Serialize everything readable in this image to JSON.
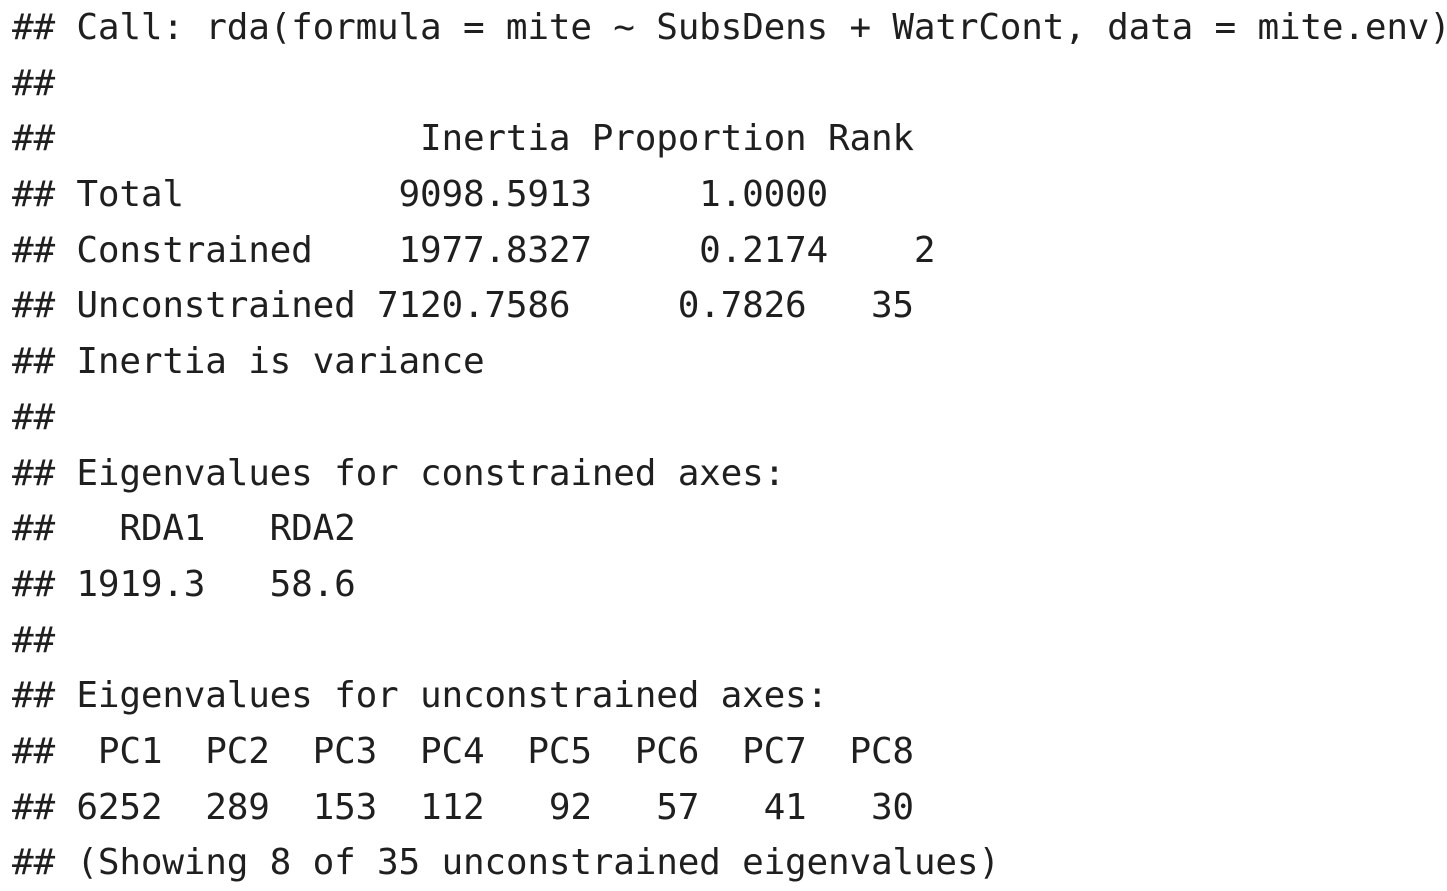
{
  "output": {
    "lines": [
      "## Call: rda(formula = mite ~ SubsDens + WatrCont, data = mite.env)",
      "##",
      "##                 Inertia Proportion Rank",
      "## Total          9098.5913     1.0000",
      "## Constrained    1977.8327     0.2174    2",
      "## Unconstrained 7120.7586     0.7826   35",
      "## Inertia is variance",
      "##",
      "## Eigenvalues for constrained axes:",
      "##   RDA1   RDA2",
      "## 1919.3   58.6",
      "##",
      "## Eigenvalues for unconstrained axes:",
      "##  PC1  PC2  PC3  PC4  PC5  PC6  PC7  PC8",
      "## 6252  289  153  112   92   57   41   30",
      "## (Showing 8 of 35 unconstrained eigenvalues)"
    ]
  }
}
